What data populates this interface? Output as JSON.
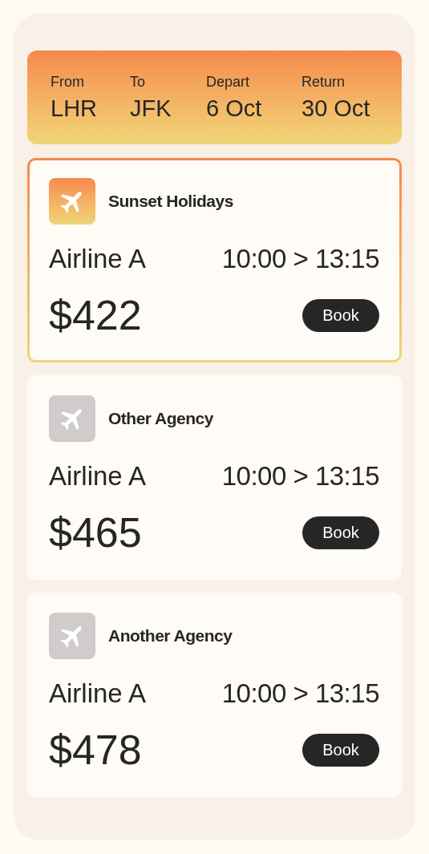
{
  "search_summary": [
    {
      "label": "From",
      "value": "LHR"
    },
    {
      "label": "To",
      "value": "JFK"
    },
    {
      "label": "Depart",
      "value": "6 Oct"
    },
    {
      "label": "Return",
      "value": "30 Oct"
    }
  ],
  "results": [
    {
      "agency": "Sunset Holidays",
      "airline": "Airline A",
      "times": "10:00 > 13:15",
      "price": "$422",
      "button": "Book",
      "selected": true
    },
    {
      "agency": "Other Agency",
      "airline": "Airline A",
      "times": "10:00 > 13:15",
      "price": "$465",
      "button": "Book",
      "selected": false
    },
    {
      "agency": "Another Agency",
      "airline": "Airline A",
      "times": "10:00 > 13:15",
      "price": "$478",
      "button": "Book",
      "selected": false
    }
  ]
}
